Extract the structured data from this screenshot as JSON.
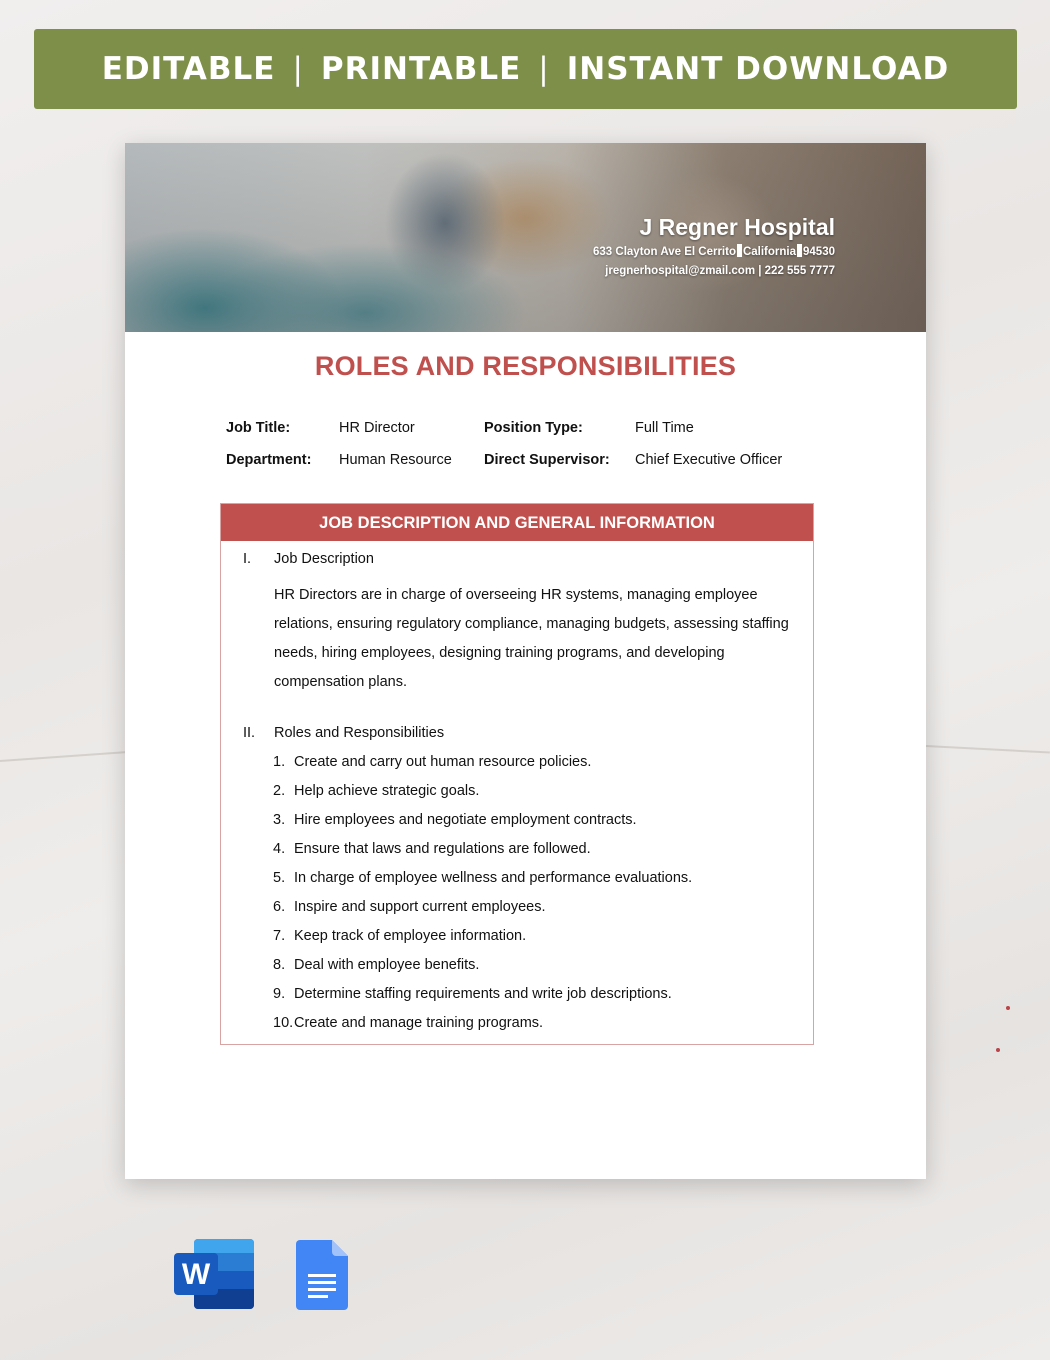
{
  "banner": {
    "items": [
      "EDITABLE",
      "PRINTABLE",
      "INSTANT DOWNLOAD"
    ],
    "separator": "|",
    "color": "#7d8f48"
  },
  "header": {
    "hospital_name": "J Regner Hospital",
    "address": {
      "street_city": "633 Clayton Ave El Cerrito",
      "state": "California",
      "zip": "94530"
    },
    "contact": "jregnerhospital@zmail.com | 222 555 7777"
  },
  "document": {
    "title": "ROLES AND RESPONSIBILITIES",
    "accent_color": "#c0504d",
    "info": {
      "job_title_label": "Job Title:",
      "job_title_value": "HR Director",
      "position_type_label": "Position Type:",
      "position_type_value": "Full Time",
      "department_label": "Department:",
      "department_value": "Human Resource",
      "supervisor_label": "Direct Supervisor:",
      "supervisor_value": "Chief Executive Officer"
    },
    "section_header": "JOB DESCRIPTION AND GENERAL INFORMATION",
    "sections": [
      {
        "numeral": "I.",
        "title": "Job Description",
        "paragraph": "HR Directors are in charge of overseeing HR systems, managing employee relations, ensuring regulatory compliance, managing budgets, assessing staffing needs, hiring employees, designing training programs, and developing compensation plans."
      },
      {
        "numeral": "II.",
        "title": "Roles and Responsibilities",
        "items": [
          {
            "num": "1.",
            "text": "Create and carry out human resource policies."
          },
          {
            "num": "2.",
            "text": "Help achieve strategic goals."
          },
          {
            "num": "3.",
            "text": "Hire employees and negotiate employment contracts."
          },
          {
            "num": "4.",
            "text": "Ensure that laws and regulations are followed."
          },
          {
            "num": "5.",
            "text": "In charge of employee wellness and performance evaluations."
          },
          {
            "num": "6.",
            "text": "Inspire and support current employees."
          },
          {
            "num": "7.",
            "text": "Keep track of employee information."
          },
          {
            "num": "8.",
            "text": "Deal with employee benefits."
          },
          {
            "num": "9.",
            "text": "Determine staffing requirements and write job descriptions."
          },
          {
            "num": "10.",
            "text": "Create and manage training programs."
          }
        ]
      }
    ]
  },
  "apps": {
    "word": {
      "icon": "microsoft-word-icon",
      "letter": "W"
    },
    "docs": {
      "icon": "google-docs-icon"
    }
  }
}
